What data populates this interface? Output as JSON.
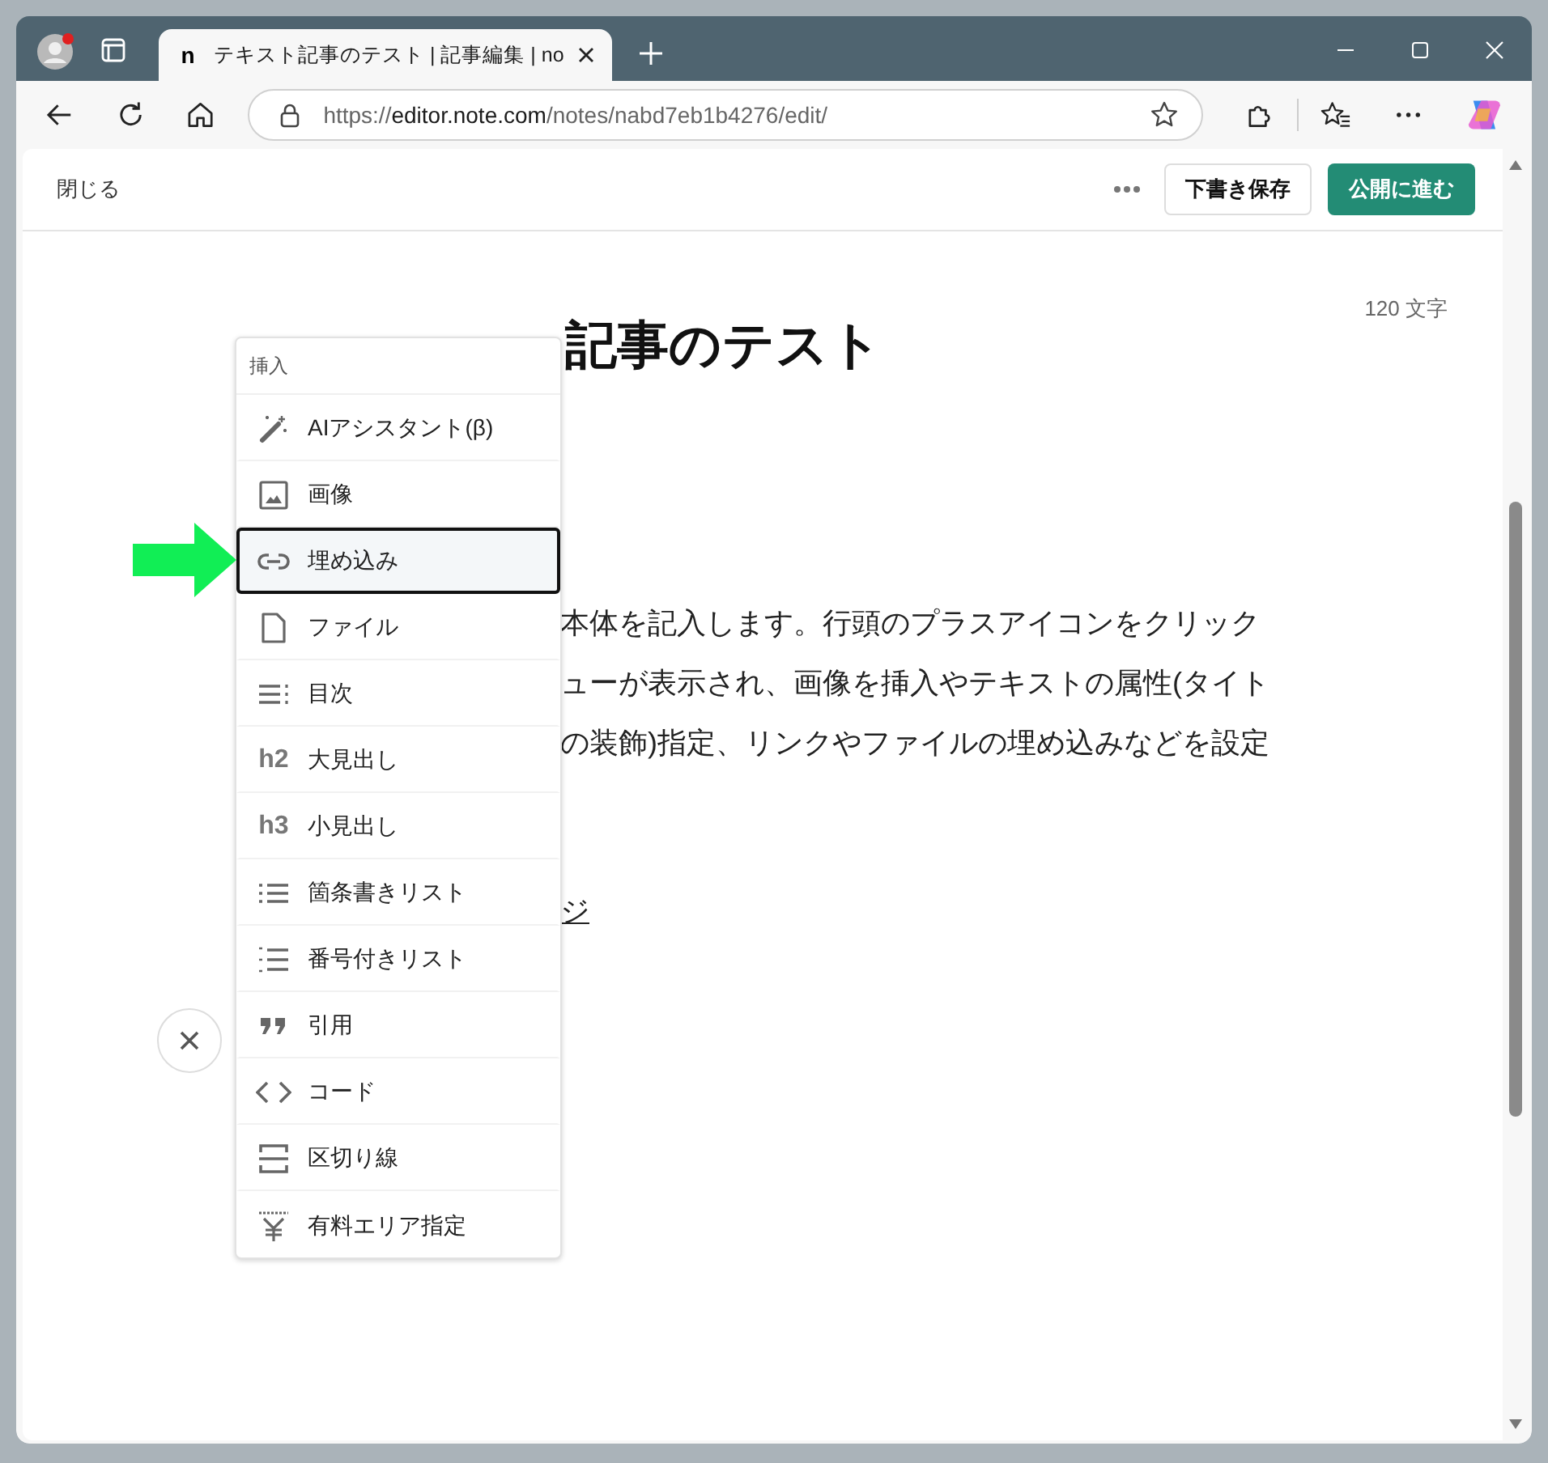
{
  "browser": {
    "tab": {
      "favicon": "n",
      "title": "テキスト記事のテスト | 記事編集 | no",
      "selected": true
    },
    "address": {
      "scheme": "https://",
      "host": "editor.note.com",
      "path": "/notes/nabd7eb1b4276/edit/"
    }
  },
  "editor": {
    "close": "閉じる",
    "save_draft": "下書き保存",
    "publish": "公開に進む",
    "char_count": "120 文字",
    "title": "記事のテスト",
    "body_lines": [
      "本体を記入します。行頭のプラスアイコンをクリック",
      "ューが表示され、画像を挿入やテキストの属性(タイト",
      "の装飾)指定、リンクやファイルの埋め込みなどを設定"
    ],
    "link_text": "ジ"
  },
  "insert_menu": {
    "heading": "挿入",
    "items": [
      {
        "kind": "ai",
        "label": "AIアシスタント(β)",
        "selected": false
      },
      {
        "kind": "image",
        "label": "画像",
        "selected": false
      },
      {
        "kind": "link",
        "label": "埋め込み",
        "selected": true
      },
      {
        "kind": "file",
        "label": "ファイル",
        "selected": false
      },
      {
        "kind": "toc",
        "label": "目次",
        "selected": false
      },
      {
        "kind": "heading",
        "icon_text": "h2",
        "label": "大見出し",
        "selected": false
      },
      {
        "kind": "heading",
        "icon_text": "h3",
        "label": "小見出し",
        "selected": false
      },
      {
        "kind": "bullet",
        "label": "箇条書きリスト",
        "selected": false
      },
      {
        "kind": "numbered",
        "label": "番号付きリスト",
        "selected": false
      },
      {
        "kind": "quote",
        "label": "引用",
        "selected": false
      },
      {
        "kind": "code",
        "label": "コード",
        "selected": false
      },
      {
        "kind": "divider",
        "label": "区切り線",
        "selected": false
      },
      {
        "kind": "paywall",
        "label": "有料エリア指定",
        "selected": false
      }
    ]
  }
}
